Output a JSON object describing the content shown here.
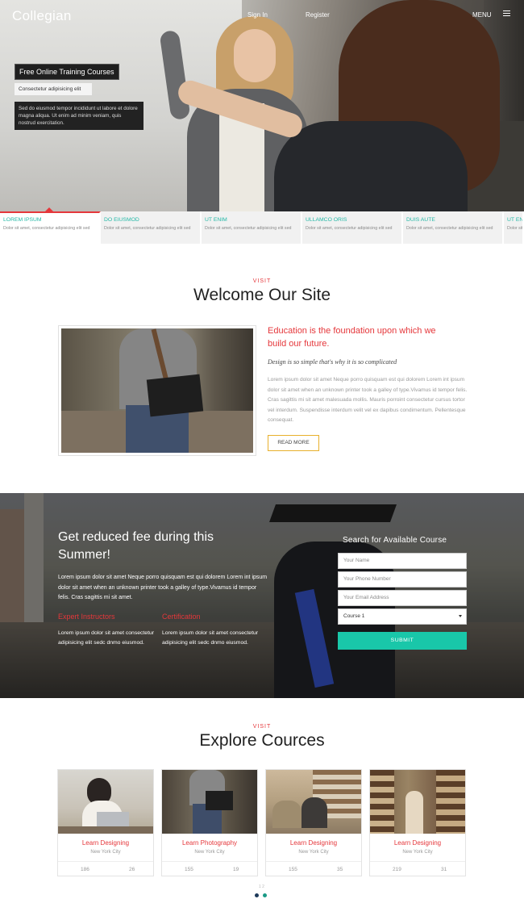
{
  "header": {
    "logo": "Collegian",
    "nav": [
      {
        "label": "Sign In"
      },
      {
        "label": "Register"
      }
    ],
    "menu_label": "MENU"
  },
  "hero": {
    "title": "Free Online Training Courses",
    "subtitle": "Consectetur adipisicing elit",
    "paragraph": "Sed do eiusmod tempor incididunt ut labore et dolore magna aliqua. Ut enim ad minim veniam, quis nostrud exercitation."
  },
  "features": [
    {
      "title": "LOREM IPSUM",
      "desc": "Dolor sit amet, consectetur adipisicing elit sed"
    },
    {
      "title": "DO EIUSMOD",
      "desc": "Dolor sit amet, consectetur adipisicing elit sed"
    },
    {
      "title": "UT ENIM",
      "desc": "Dolor sit amet, consectetur adipisicing elit sed"
    },
    {
      "title": "ULLAMCO ORIS",
      "desc": "Dolor sit amet, consectetur adipisicing elit sed"
    },
    {
      "title": "DUIS AUTE",
      "desc": "Dolor sit amet, consectetur adipisicing elit sed"
    },
    {
      "title": "UT EN",
      "desc": "Dolor sit amet, consectetur adipisicing elit sed"
    }
  ],
  "welcome": {
    "kicker": "VISIT",
    "title": "Welcome Our Site",
    "heading": "Education is the foundation upon which we build our future.",
    "italic": "Design is so simple that's why it is so complicated",
    "body": "Lorem ipsum dolor sit amet Neque porro quisquam est qui dolorem Lorem int ipsum dolor sit amet when an unknown printer took a galley of type.Vivamus id tempor felis. Cras sagittis mi sit amet malesuada mollis. Mauris porroint consectetur cursus tortor vel interdum. Suspendisse interdum velit vel ex dapibus condimentum. Pellentesque consequat.",
    "read_more": "READ MORE"
  },
  "promo": {
    "title": "Get reduced fee during this Summer!",
    "body": "Lorem ipsum dolor sit amet Neque porro quisquam est qui dolorem Lorem int ipsum dolor sit amet when an unknown printer took a galley of type.Vivamus id tempor felis. Cras sagittis mi sit amet.",
    "col1_title": "Expert Instructors",
    "col1_text": "Lorem ipsum dolor sit amet consectetur adipisicing elit sedc dnmo eiusmod.",
    "col2_title": "Certification",
    "col2_text": "Lorem ipsum dolor sit amet consectetur adipisicing elit sedc dnmo eiusmod.",
    "form": {
      "title": "Search for Available Course",
      "name_placeholder": "Your Name",
      "phone_placeholder": "Your Phone Number",
      "email_placeholder": "Your Email Address",
      "course_selected": "Course 1",
      "submit": "SUBMIT"
    }
  },
  "courses": {
    "kicker": "VISIT",
    "title": "Explore Cources",
    "items": [
      {
        "title": "Learn Designing",
        "location": "New York City",
        "stat_a": "186",
        "stat_b": "26"
      },
      {
        "title": "Learn Photography",
        "location": "New York City",
        "stat_a": "155",
        "stat_b": "19"
      },
      {
        "title": "Learn Designing",
        "location": "New York City",
        "stat_a": "155",
        "stat_b": "35"
      },
      {
        "title": "Learn Designing",
        "location": "New York City",
        "stat_a": "219",
        "stat_b": "31"
      }
    ],
    "pager_mark": "1 2"
  },
  "colors": {
    "accent_red": "#e5373b",
    "accent_teal": "#19c7a9",
    "button_border": "#e8b02c"
  }
}
